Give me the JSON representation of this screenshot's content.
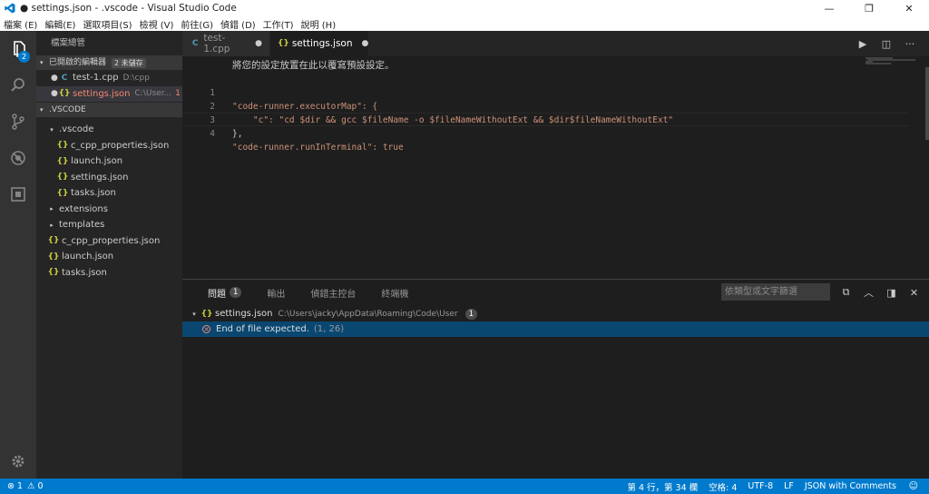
{
  "window": {
    "title": "● settings.json - .vscode - Visual Studio Code",
    "minimize": "—",
    "restore": "❐",
    "close": "✕"
  },
  "menu": [
    "檔案 (E)",
    "編輯(E)",
    "選取項目(S)",
    "檢視 (V)",
    "前往(G)",
    "偵錯 (D)",
    "工作(T)",
    "說明 (H)"
  ],
  "activity": {
    "explorer_badge": "2"
  },
  "sidebar": {
    "title": "檔案總管",
    "open_editors": {
      "label": "已開啟的編輯器",
      "badge": "2 未儲存",
      "items": [
        {
          "name": "test-1.cpp",
          "desc": "D:\\cpp",
          "problems": ""
        },
        {
          "name": "settings.json",
          "desc": "C:\\User...",
          "problems": "1"
        }
      ]
    },
    "folder": {
      "label": ".VSCODE",
      "items": [
        {
          "label": ".vscode",
          "kind": "folder-open",
          "depth": 1
        },
        {
          "label": "c_cpp_properties.json",
          "kind": "json",
          "depth": 2
        },
        {
          "label": "launch.json",
          "kind": "json",
          "depth": 2
        },
        {
          "label": "settings.json",
          "kind": "json",
          "depth": 2
        },
        {
          "label": "tasks.json",
          "kind": "json",
          "depth": 2
        },
        {
          "label": "extensions",
          "kind": "folder",
          "depth": 1
        },
        {
          "label": "templates",
          "kind": "folder",
          "depth": 1
        },
        {
          "label": "c_cpp_properties.json",
          "kind": "json",
          "depth": 1
        },
        {
          "label": "launch.json",
          "kind": "json",
          "depth": 1
        },
        {
          "label": "tasks.json",
          "kind": "json",
          "depth": 1
        }
      ]
    }
  },
  "tabs": [
    {
      "label": "test-1.cpp",
      "dirty": "●",
      "icon": "C"
    },
    {
      "label": "settings.json",
      "dirty": "●",
      "icon": "{}"
    }
  ],
  "editor": {
    "hint": "將您的設定放置在此以覆寫預設設定。",
    "lines": [
      {
        "n": "1",
        "text": "\"code-runner.executorMap\": {"
      },
      {
        "n": "2",
        "text": "    \"c\": \"cd $dir && gcc $fileName -o $fileNameWithoutExt && $dir$fileNameWithoutExt\""
      },
      {
        "n": "3",
        "text": "},"
      },
      {
        "n": "4",
        "text": "\"code-runner.runInTerminal\": true"
      }
    ]
  },
  "panel": {
    "tabs": [
      {
        "label": "問題",
        "badge": "1"
      },
      {
        "label": "輸出",
        "badge": ""
      },
      {
        "label": "偵錯主控台",
        "badge": ""
      },
      {
        "label": "終端機",
        "badge": ""
      }
    ],
    "filter_placeholder": "依類型或文字篩選",
    "file": {
      "name": "settings.json",
      "path": "C:\\Users\\jacky\\AppData\\Roaming\\Code\\User",
      "count": "1"
    },
    "problem": {
      "message": "End of file expected.",
      "location": "(1, 26)"
    }
  },
  "status": {
    "errors": "1",
    "warnings": "0",
    "position": "第 4 行，第 34 欄",
    "spaces": "空格: 4",
    "encoding": "UTF-8",
    "eol": "LF",
    "language": "JSON with Comments"
  }
}
